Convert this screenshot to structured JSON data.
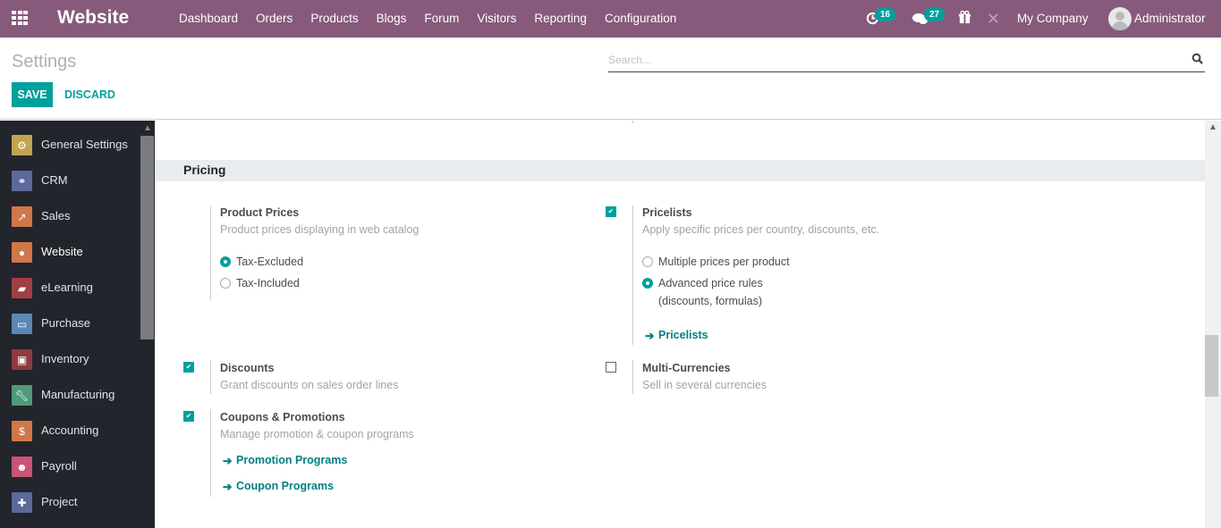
{
  "topbar": {
    "app_name": "Website",
    "nav": [
      "Dashboard",
      "Orders",
      "Products",
      "Blogs",
      "Forum",
      "Visitors",
      "Reporting",
      "Configuration"
    ],
    "activity_count": "16",
    "messages_count": "27",
    "company": "My Company",
    "user": "Administrator"
  },
  "control_panel": {
    "title": "Settings",
    "save_label": "SAVE",
    "discard_label": "DISCARD",
    "search_placeholder": "Search..."
  },
  "sidebar": {
    "items": [
      {
        "label": "General Settings",
        "icon": "gear-icon",
        "color": "#c1a54f"
      },
      {
        "label": "CRM",
        "icon": "handshake-icon",
        "color": "#5b6a9a"
      },
      {
        "label": "Sales",
        "icon": "chart-line-icon",
        "color": "#d0774a"
      },
      {
        "label": "Website",
        "icon": "globe-icon",
        "color": "#d0774a",
        "active": true
      },
      {
        "label": "eLearning",
        "icon": "elearning-icon",
        "color": "#a13f45"
      },
      {
        "label": "Purchase",
        "icon": "credit-card-icon",
        "color": "#5c87b5"
      },
      {
        "label": "Inventory",
        "icon": "box-icon",
        "color": "#8e3a3e"
      },
      {
        "label": "Manufacturing",
        "icon": "wrench-icon",
        "color": "#4f9a78"
      },
      {
        "label": "Accounting",
        "icon": "invoice-icon",
        "color": "#d0774a"
      },
      {
        "label": "Payroll",
        "icon": "payroll-icon",
        "color": "#c85577"
      },
      {
        "label": "Project",
        "icon": "puzzle-icon",
        "color": "#5b6a9a"
      }
    ]
  },
  "section": {
    "title": "Pricing"
  },
  "settings": {
    "product_prices": {
      "title": "Product Prices",
      "desc": "Product prices displaying in web catalog",
      "options": [
        "Tax-Excluded",
        "Tax-Included"
      ],
      "selected": "Tax-Excluded"
    },
    "pricelists": {
      "title": "Pricelists",
      "desc": "Apply specific prices per country, discounts, etc.",
      "checked": true,
      "options": [
        "Multiple prices per product",
        "Advanced price rules",
        "(discounts, formulas)"
      ],
      "selected": "Advanced price rules",
      "link": "Pricelists"
    },
    "discounts": {
      "title": "Discounts",
      "desc": "Grant discounts on sales order lines",
      "checked": true
    },
    "multi_currencies": {
      "title": "Multi-Currencies",
      "desc": "Sell in several currencies",
      "checked": false
    },
    "coupons": {
      "title": "Coupons & Promotions",
      "desc": "Manage promotion & coupon programs",
      "checked": true,
      "links": [
        "Promotion Programs",
        "Coupon Programs"
      ]
    }
  },
  "colors": {
    "brand": "#875a7b",
    "accent": "#00a09d"
  }
}
